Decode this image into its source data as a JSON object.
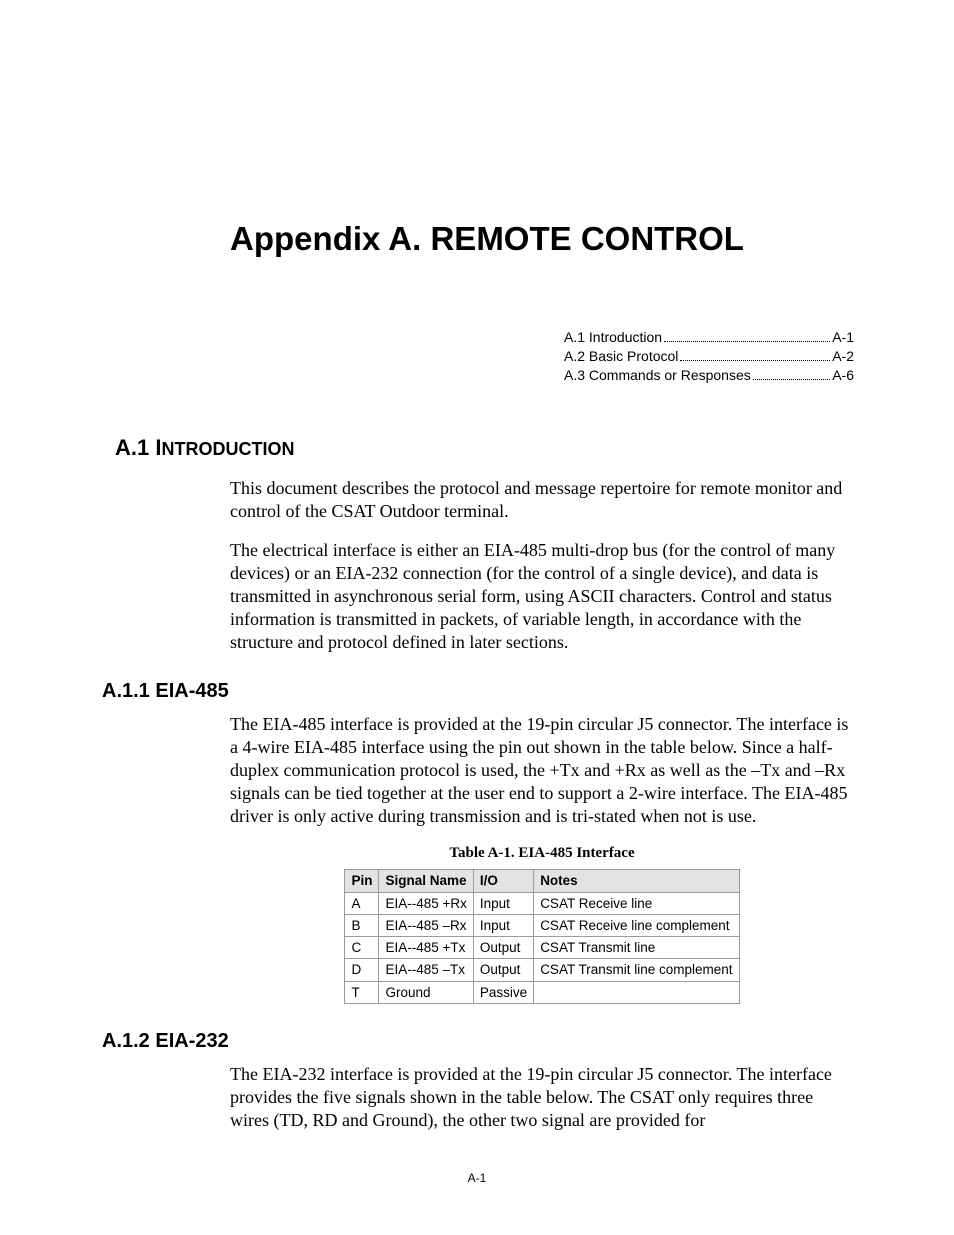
{
  "title": "Appendix A. REMOTE CONTROL",
  "toc": [
    {
      "label": "A.1 Introduction",
      "page": "A-1"
    },
    {
      "label": "A.2 Basic Protocol",
      "page": "A-2"
    },
    {
      "label": "A.3 Commands or Responses",
      "page": "A-6"
    }
  ],
  "sections": {
    "a1": {
      "num": "A.1",
      "title_big": "I",
      "title_rest": "NTRODUCTION",
      "p1": "This document describes the protocol and message repertoire for remote monitor and control of the CSAT Outdoor terminal.",
      "p2": "The electrical interface is either an EIA-485 multi-drop bus (for the control of many devices) or an EIA-232 connection (for the control of a single device), and data is transmitted in asynchronous serial form, using ASCII characters. Control and status information is transmitted in packets, of variable length, in accordance with the structure and protocol defined in later sections."
    },
    "a11": {
      "heading": "A.1.1 EIA-485",
      "p1": "The EIA-485 interface is provided at the 19-pin circular J5 connector.  The interface is a 4-wire EIA-485 interface using the pin out shown in the table below.  Since a half-duplex communication protocol is used, the +Tx and +Rx as well as the –Tx and –Rx signals can be tied together at the user end to support a 2-wire interface.  The EIA-485 driver is only active during transmission and is tri-stated when not is use.",
      "table_caption": "Table A-1.   EIA-485 Interface",
      "table": {
        "headers": [
          "Pin",
          "Signal Name",
          "I/O",
          "Notes"
        ],
        "rows": [
          [
            "A",
            "EIA--485 +Rx",
            "Input",
            "CSAT Receive line"
          ],
          [
            "B",
            "EIA--485 –Rx",
            "Input",
            "CSAT Receive line complement"
          ],
          [
            "C",
            "EIA--485 +Tx",
            "Output",
            "CSAT Transmit line"
          ],
          [
            "D",
            "EIA--485 –Tx",
            "Output",
            "CSAT Transmit line complement"
          ],
          [
            "T",
            "Ground",
            "Passive",
            ""
          ]
        ]
      }
    },
    "a12": {
      "heading": "A.1.2 EIA-232",
      "p1": "The EIA-232 interface is provided at the 19-pin circular J5 connector.  The interface provides the five signals shown in the table below.  The CSAT only requires three wires (TD, RD and Ground), the other two signal are provided for"
    }
  },
  "footer": "A-1"
}
